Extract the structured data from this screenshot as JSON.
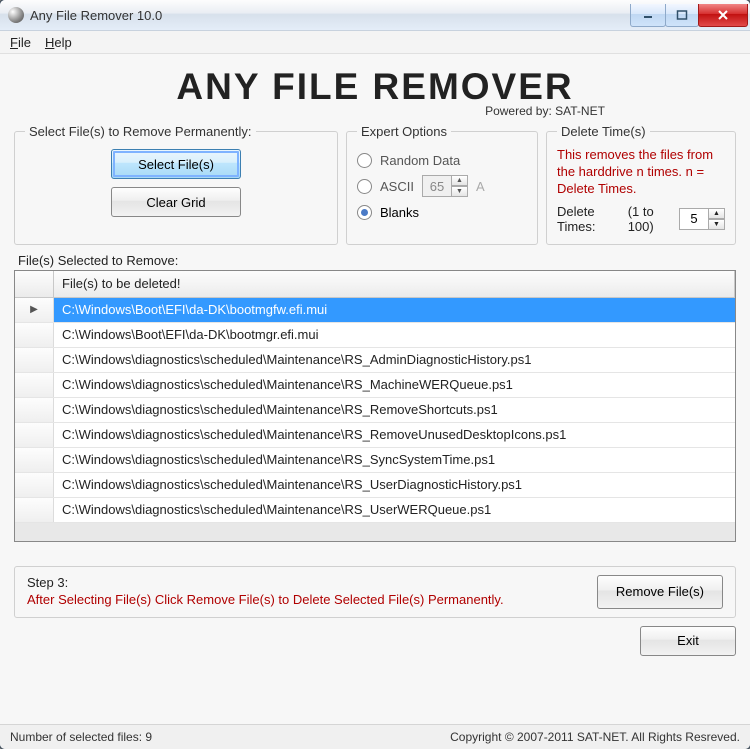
{
  "titlebar": {
    "title": "Any File Remover 10.0"
  },
  "menu": {
    "file": "File",
    "help": "Help"
  },
  "logo": {
    "big": "ANY FILE REMOVER",
    "sub": "Powered by: SAT-NET"
  },
  "selectGroup": {
    "legend": "Select File(s) to Remove Permanently:",
    "selectBtn": "Select File(s)",
    "clearBtn": "Clear Grid"
  },
  "expertGroup": {
    "legend": "Expert Options",
    "random": "Random Data",
    "ascii": "ASCII",
    "asciiValue": "65",
    "asciiSuffix": "A",
    "blanks": "Blanks"
  },
  "deleteGroup": {
    "legend": "Delete Time(s)",
    "warning": "This removes the files from the harddrive n times. n = Delete Times.",
    "label": "Delete Times:",
    "range": "(1 to 100)",
    "value": "5"
  },
  "grid": {
    "label": "File(s) Selected to Remove:",
    "header": "File(s) to be deleted!",
    "rows": [
      "C:\\Windows\\Boot\\EFI\\da-DK\\bootmgfw.efi.mui",
      "C:\\Windows\\Boot\\EFI\\da-DK\\bootmgr.efi.mui",
      "C:\\Windows\\diagnostics\\scheduled\\Maintenance\\RS_AdminDiagnosticHistory.ps1",
      "C:\\Windows\\diagnostics\\scheduled\\Maintenance\\RS_MachineWERQueue.ps1",
      "C:\\Windows\\diagnostics\\scheduled\\Maintenance\\RS_RemoveShortcuts.ps1",
      "C:\\Windows\\diagnostics\\scheduled\\Maintenance\\RS_RemoveUnusedDesktopIcons.ps1",
      "C:\\Windows\\diagnostics\\scheduled\\Maintenance\\RS_SyncSystemTime.ps1",
      "C:\\Windows\\diagnostics\\scheduled\\Maintenance\\RS_UserDiagnosticHistory.ps1",
      "C:\\Windows\\diagnostics\\scheduled\\Maintenance\\RS_UserWERQueue.ps1"
    ],
    "selectedIndex": 0
  },
  "step3": {
    "line1": "Step 3:",
    "line2": "After Selecting File(s) Click Remove File(s) to Delete Selected File(s) Permanently.",
    "removeBtn": "Remove File(s)"
  },
  "exitBtn": "Exit",
  "status": {
    "left": "Number of selected files:  9",
    "right": "Copyright © 2007-2011 SAT-NET. All Rights Resreved."
  }
}
